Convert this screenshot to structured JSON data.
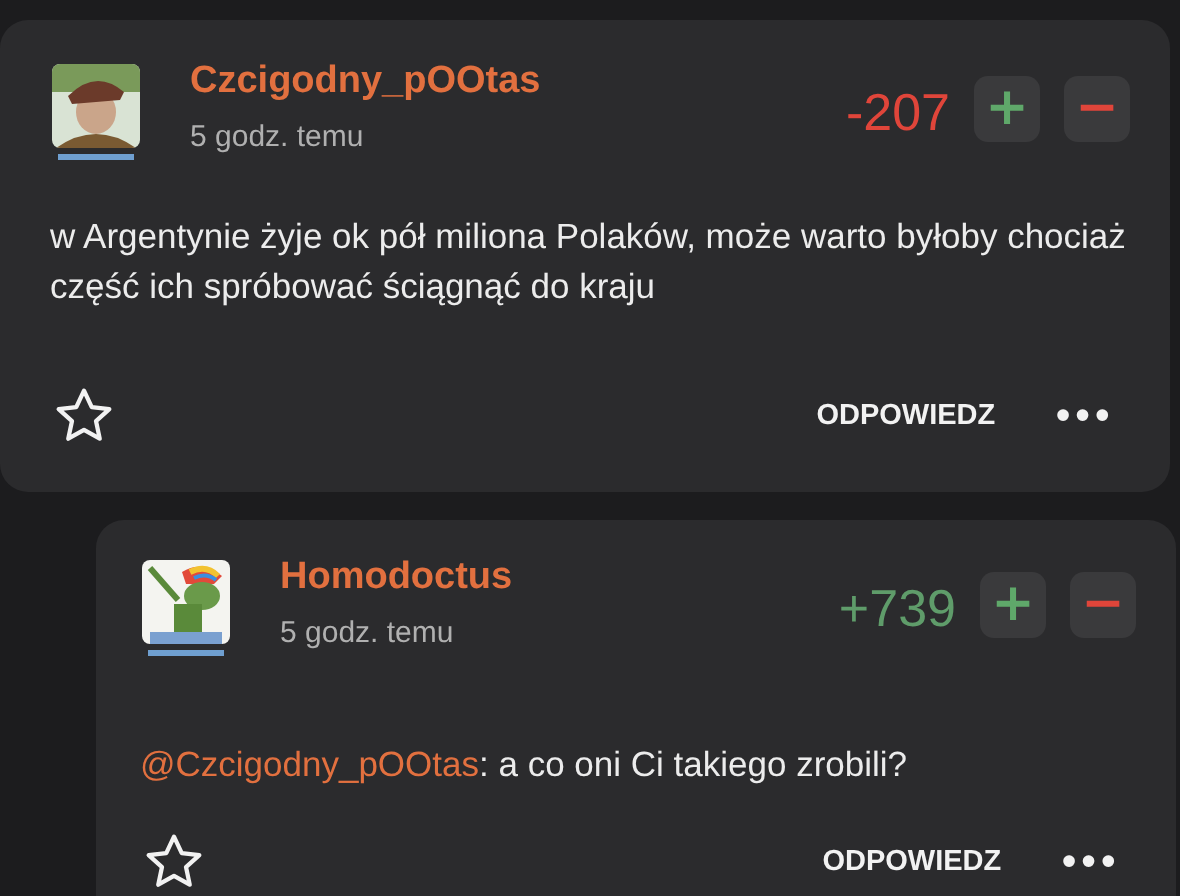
{
  "comments": [
    {
      "author": "Czcigodny_pOOtas",
      "time": "5 godz. temu",
      "score": {
        "text": "-207",
        "color": "#e0453a"
      },
      "vote_up": "+",
      "vote_down": "−",
      "reply": false,
      "body": {
        "text": "w Argentynie żyje ok pół miliona Polaków, może warto byłoby chociaż część ich spróbować ściągnąć do kraju"
      },
      "reply_label": "ODPOWIEDZ",
      "more": "•••",
      "starred": false
    },
    {
      "author": "Homodoctus",
      "time": "5 godz. temu",
      "score": {
        "text": "+739",
        "color": "#5f9c6a"
      },
      "vote_up": "+",
      "vote_down": "−",
      "reply": true,
      "body": {
        "mention": "@Czcigodny_pOOtas",
        "text": ": a co oni Ci takiego zrobili?"
      },
      "reply_label": "ODPOWIEDZ",
      "more": "•••",
      "starred": false
    }
  ]
}
